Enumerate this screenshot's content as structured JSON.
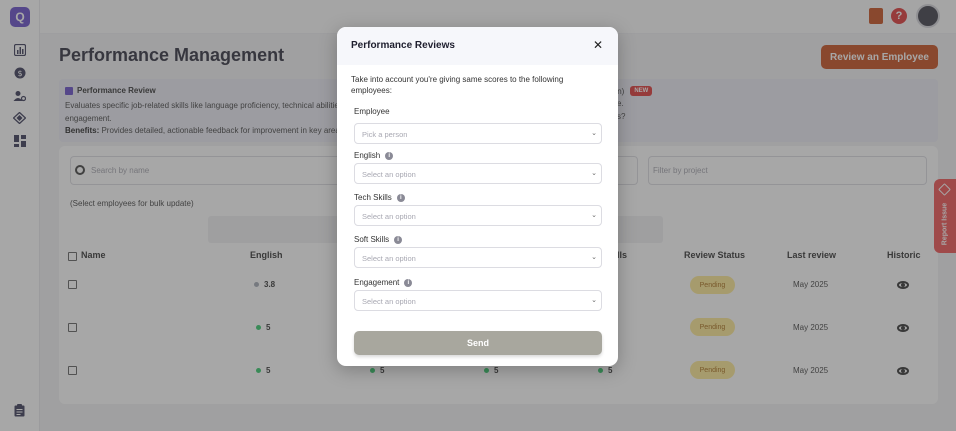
{
  "header": {
    "page_title": "Performance Management",
    "review_button": "Review an Employee"
  },
  "info_panel": {
    "title": "Performance Review",
    "description": "Evaluates specific job-related skills like language proficiency, technical abilities",
    "description_tail": "engagement.",
    "benefits_label": "Benefits:",
    "benefits_text": "Provides detailed, actionable feedback for improvement in key areas",
    "right_fragment": "sion)",
    "new_badge": "NEW",
    "right_line2": "e.",
    "right_line3": "s?"
  },
  "filters": {
    "search_placeholder": "Search by name",
    "project_placeholder": "Filter by project",
    "bulk_note": "(Select employees for bulk update)"
  },
  "table": {
    "headers": {
      "name": "Name",
      "english": "English",
      "skills": "lls",
      "status": "Review Status",
      "last_review": "Last review",
      "historic": "Historic"
    },
    "rows": [
      {
        "english": "3.8",
        "col2": "",
        "col3": "",
        "col4": "",
        "status": "Pending",
        "last_review": "May 2025"
      },
      {
        "english": "5",
        "col2": "",
        "col3": "",
        "col4": "",
        "status": "Pending",
        "last_review": "May 2025"
      },
      {
        "english": "5",
        "col2": "5",
        "col3": "5",
        "col4": "5",
        "status": "Pending",
        "last_review": "May 2025"
      }
    ]
  },
  "report_tab": {
    "label": "Report Issue"
  },
  "modal": {
    "title": "Performance Reviews",
    "intro": "Take into account you're giving same scores to the following employees:",
    "fields": [
      {
        "label": "Employee",
        "placeholder": "Pick a person",
        "info": false
      },
      {
        "label": "English",
        "placeholder": "Select an option",
        "info": true
      },
      {
        "label": "Tech Skills",
        "placeholder": "Select an option",
        "info": true
      },
      {
        "label": "Soft Skills",
        "placeholder": "Select an option",
        "info": true
      },
      {
        "label": "Engagement",
        "placeholder": "Select an option",
        "info": true
      }
    ],
    "send_button": "Send"
  },
  "colors": {
    "accent": "#c2410c",
    "brand": "#5b3fc4",
    "pending_bg": "#fde68a",
    "send_button": "#a8a79e",
    "report_tab": "#ef4444"
  },
  "icons": [
    "logo-icon",
    "chart-icon",
    "dollar-icon",
    "users-cog-icon",
    "diamond-icon",
    "dashboard-icon",
    "clipboard-icon",
    "document-icon",
    "help-icon",
    "close-icon",
    "info-icon",
    "chevron-down-icon",
    "eye-icon",
    "pencil-icon",
    "search-icon"
  ]
}
